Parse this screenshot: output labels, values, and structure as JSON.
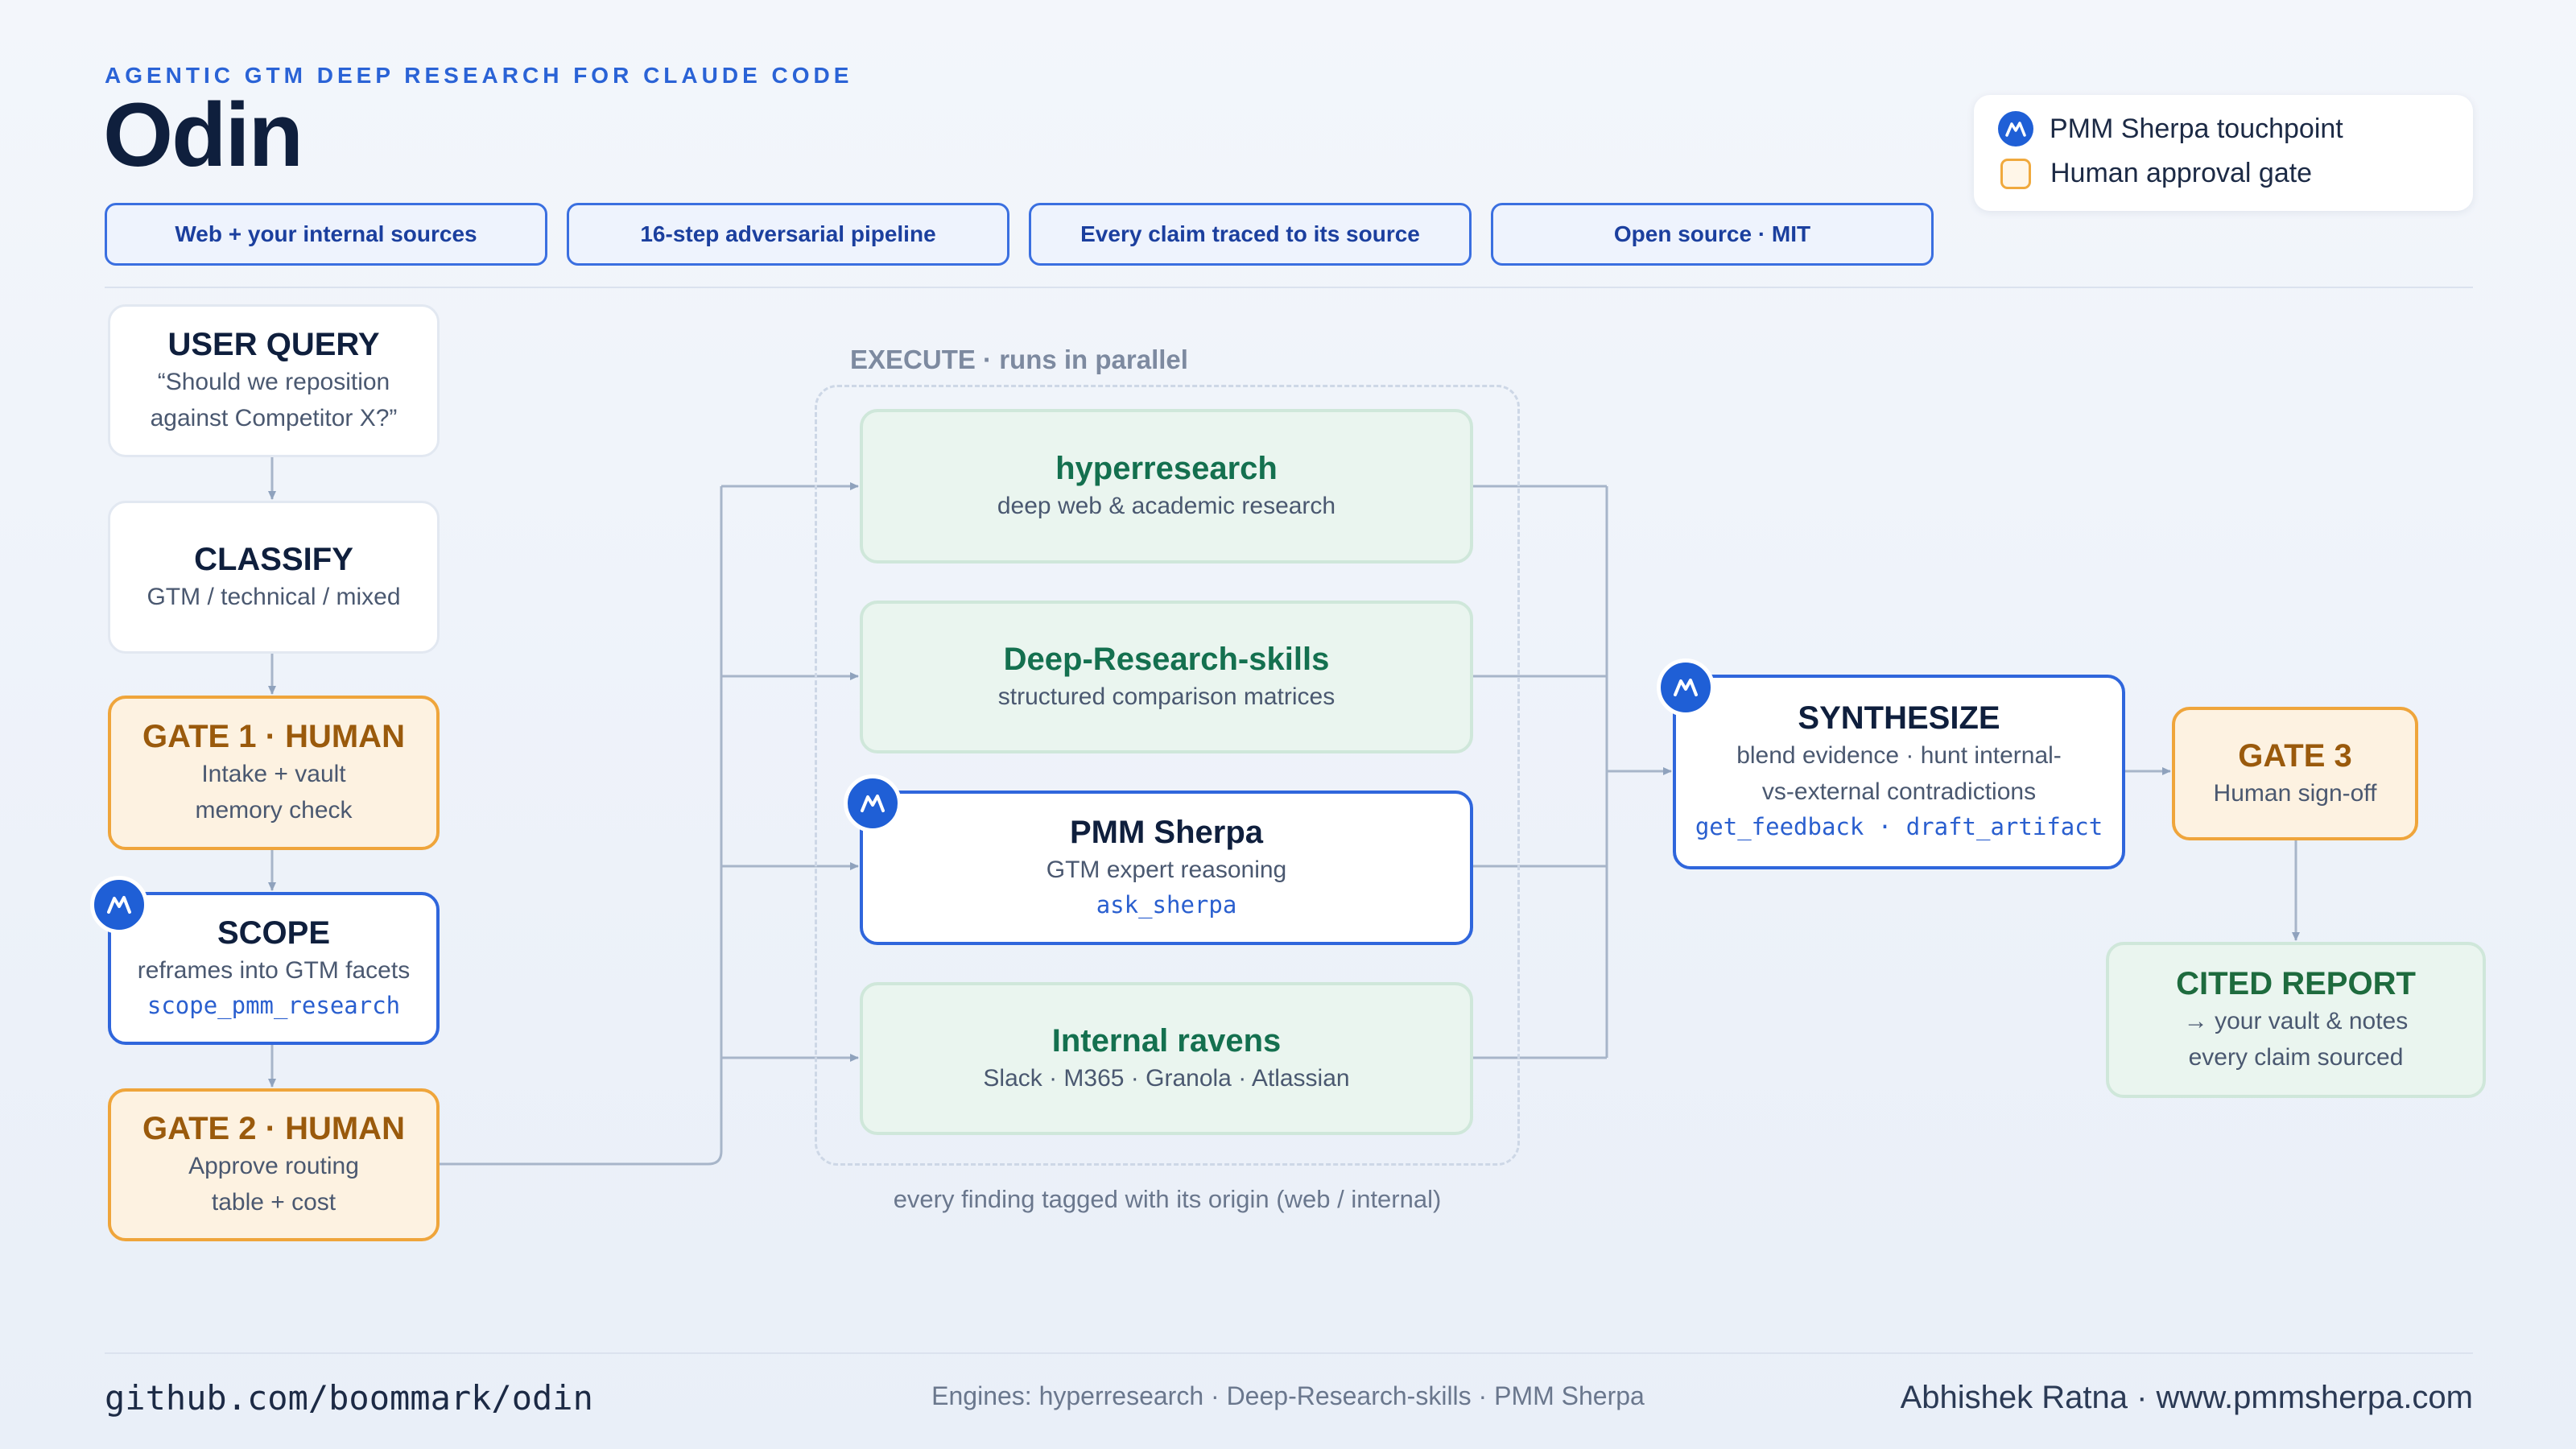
{
  "header": {
    "eyebrow": "AGENTIC GTM DEEP RESEARCH FOR CLAUDE CODE",
    "title": "Odin",
    "pills": [
      "Web + your internal sources",
      "16-step adversarial pipeline",
      "Every claim traced to its source",
      "Open source · MIT"
    ]
  },
  "legend": {
    "sherpa": "PMM Sherpa touchpoint",
    "gate": "Human approval gate"
  },
  "flow": {
    "user_query": {
      "title": "USER QUERY",
      "line1": "“Should we reposition",
      "line2": "against Competitor X?”"
    },
    "classify": {
      "title": "CLASSIFY",
      "line1": "GTM / technical / mixed"
    },
    "gate1": {
      "title": "GATE 1 · HUMAN",
      "line1": "Intake + vault",
      "line2": "memory check"
    },
    "scope": {
      "title": "SCOPE",
      "line1": "reframes into GTM facets",
      "code": "scope_pmm_research"
    },
    "gate2": {
      "title": "GATE 2 · HUMAN",
      "line1": "Approve routing",
      "line2": "table + cost"
    }
  },
  "execute": {
    "label": "EXECUTE · runs in parallel",
    "footnote": "every finding tagged with its origin (web / internal)",
    "engines": [
      {
        "title": "hyperresearch",
        "sub": "deep web & academic research"
      },
      {
        "title": "Deep-Research-skills",
        "sub": "structured comparison matrices"
      },
      {
        "title": "PMM Sherpa",
        "sub": "GTM expert reasoning",
        "code": "ask_sherpa"
      },
      {
        "title": "Internal ravens",
        "sub": "Slack · M365 · Granola · Atlassian"
      }
    ]
  },
  "synthesize": {
    "title": "SYNTHESIZE",
    "line1": "blend evidence · hunt internal-",
    "line2": "vs-external contradictions",
    "code": "get_feedback · draft_artifact"
  },
  "gate3": {
    "title": "GATE 3",
    "line1": "Human sign-off"
  },
  "report": {
    "title": "CITED REPORT",
    "line1": "→ your vault & notes",
    "line2": "every claim sourced"
  },
  "footer": {
    "repo": "github.com/boommark/odin",
    "engines": "Engines: hyperresearch · Deep-Research-skills · PMM Sherpa",
    "credit": "Abhishek Ratna · www.pmmsherpa.com"
  },
  "colors": {
    "accent": "#2f66dc",
    "gate": "#efa53b",
    "engine_green": "#14704f",
    "sherpa_badge": "#1f5fd6"
  },
  "icons": {
    "sherpa_badge": "mountain-peaks-icon",
    "arrow": "arrow-right-icon"
  }
}
